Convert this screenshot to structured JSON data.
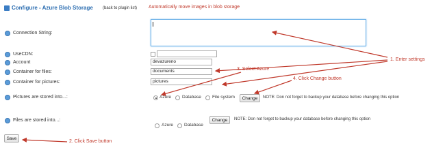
{
  "header": {
    "title": "Configure - Azure Blob Storage",
    "back_link": "(back to plugin list)",
    "caption": "Automatically move images in blob storage"
  },
  "fields": {
    "connection_string": {
      "label": "Connection String:",
      "value": ""
    },
    "use_cdn": {
      "label": "UseCDN:",
      "checked": false,
      "value": ""
    },
    "account": {
      "label": "Account",
      "value": "devazureno"
    },
    "container_files": {
      "label": "Container for files:",
      "value": "documents"
    },
    "container_pictures": {
      "label": "Container for pictures:",
      "value": "pictures"
    },
    "pictures_stored": {
      "label": "Pictures are stored into...:",
      "options": [
        "Azure",
        "Database",
        "File system"
      ],
      "selected": "Azure",
      "button": "Change",
      "note": "NOTE: Don not forget to backup your database before changing this option"
    },
    "files_stored": {
      "label": "Files are stored into...:",
      "options": [
        "Azure",
        "Database"
      ],
      "button": "Change",
      "note": "NOTE: Don not forget to backup your database before changing this option"
    }
  },
  "save_button": "Save",
  "annotations": {
    "enter_settings": "1. Enter settings",
    "click_save": "2. Click Save button",
    "select_azure": "3. Select Azure",
    "click_change": "4. Click Change button"
  },
  "colors": {
    "annotation": "#c0392b",
    "title": "#2a6cb0",
    "info_icon": "#5a9bd8"
  }
}
